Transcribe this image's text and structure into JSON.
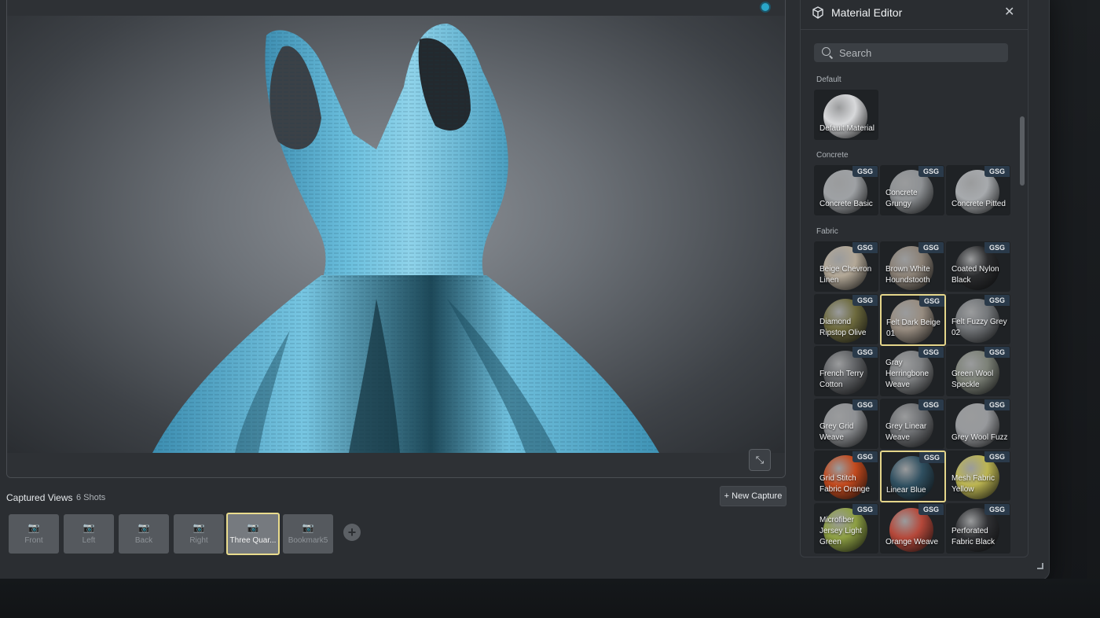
{
  "viewport": {
    "status_color": "#2aa6c9",
    "expand_icon": "expand-arrows-icon",
    "expand_glyph": "⤡"
  },
  "captured": {
    "label": "Captured Views",
    "count": "6 Shots",
    "new_capture_label": "+ New Capture",
    "camera_glyph": "📷",
    "add_glyph": "+",
    "views": [
      {
        "label": "Front",
        "selected": false
      },
      {
        "label": "Left",
        "selected": false
      },
      {
        "label": "Back",
        "selected": false
      },
      {
        "label": "Right",
        "selected": false
      },
      {
        "label": "Three Quar...",
        "selected": true
      },
      {
        "label": "Bookmark5",
        "selected": false
      }
    ]
  },
  "material_editor": {
    "title": "Material Editor",
    "title_icon": "cube-icon",
    "close_glyph": "✕",
    "search": {
      "placeholder": "Search",
      "value": ""
    },
    "badge": "GSG",
    "sections": [
      {
        "title": "Default",
        "materials": [
          {
            "name": "Default Material",
            "badge": false,
            "color": "#d8d9db",
            "selected": false
          }
        ]
      },
      {
        "title": "Concrete",
        "materials": [
          {
            "name": "Concrete Basic",
            "badge": true,
            "color": "#9ea1a4",
            "selected": false
          },
          {
            "name": "Concrete Grungy",
            "badge": true,
            "color": "#8e9194",
            "selected": false
          },
          {
            "name": "Concrete Pitted",
            "badge": true,
            "color": "#a7aaad",
            "selected": false
          }
        ]
      },
      {
        "title": "Fabric",
        "materials": [
          {
            "name": "Beige Chevron Linen",
            "badge": true,
            "color": "#b3a897",
            "selected": false
          },
          {
            "name": "Brown White Houndstooth",
            "badge": true,
            "color": "#8b8176",
            "selected": false
          },
          {
            "name": "Coated Nylon Black",
            "badge": true,
            "color": "#2b2c2e",
            "selected": false
          },
          {
            "name": "Diamond Ripstop Olive",
            "badge": true,
            "color": "#6d6a3d",
            "selected": false
          },
          {
            "name": "Felt Dark Beige 01",
            "badge": true,
            "color": "#978c80",
            "selected": true
          },
          {
            "name": "Felt Fuzzy Grey 02",
            "badge": true,
            "color": "#74777a",
            "selected": false
          },
          {
            "name": "French Terry Cotton",
            "badge": true,
            "color": "#5f6164",
            "selected": false
          },
          {
            "name": "Gray Herringbone Weave",
            "badge": true,
            "color": "#7d7f81",
            "selected": false
          },
          {
            "name": "Green Wool Speckle",
            "badge": true,
            "color": "#7c8177",
            "selected": false
          },
          {
            "name": "Grey Grid Weave",
            "badge": true,
            "color": "#8f9194",
            "selected": false
          },
          {
            "name": "Grey Linear Weave",
            "badge": true,
            "color": "#6e7073",
            "selected": false
          },
          {
            "name": "Grey Wool Fuzz",
            "badge": true,
            "color": "#97999c",
            "selected": false
          },
          {
            "name": "Grid Stitch Fabric Orange",
            "badge": true,
            "color": "#c2491d",
            "selected": false
          },
          {
            "name": "Linear Blue",
            "badge": true,
            "color": "#2f4f60",
            "selected": true
          },
          {
            "name": "Mesh Fabric Yellow",
            "badge": true,
            "color": "#bcb552",
            "selected": false
          },
          {
            "name": "Microfiber Jersey Light Green",
            "badge": true,
            "color": "#8ea043",
            "selected": false
          },
          {
            "name": "Orange Weave",
            "badge": true,
            "color": "#b5483a",
            "selected": false
          },
          {
            "name": "Perforated Fabric Black",
            "badge": true,
            "color": "#2f3033",
            "selected": false
          }
        ]
      }
    ]
  }
}
